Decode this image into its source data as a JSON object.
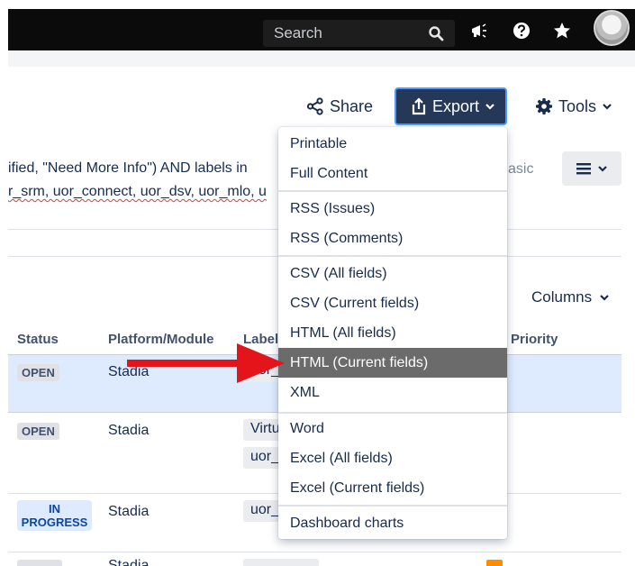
{
  "topbar": {
    "search_placeholder": "Search"
  },
  "toolbar": {
    "share_label": "Share",
    "export_label": "Export",
    "tools_label": "Tools"
  },
  "jql": {
    "line1": "ified, \"Need More Info\") AND labels in",
    "line2": "r_srm, uor_connect, uor_dsv, uor_mlo, u",
    "basic_label": "asic"
  },
  "columns_label": "Columns",
  "table": {
    "headers": {
      "status": "Status",
      "platform": "Platform/Module",
      "labels": "Labels",
      "priority": "Priority"
    },
    "rows": [
      {
        "status": "OPEN",
        "platform": "Stadia",
        "labels": [
          "uor_"
        ]
      },
      {
        "status": "OPEN",
        "platform": "Stadia",
        "labels": [
          "Virtu",
          "uor_"
        ]
      },
      {
        "status_line1": "IN",
        "status_line2": "PROGRESS",
        "platform": "Stadia",
        "labels": [
          "uor_"
        ]
      },
      {
        "platform": "Stadia"
      }
    ]
  },
  "export_menu": {
    "items": [
      "Printable",
      "Full Content",
      "RSS (Issues)",
      "RSS (Comments)",
      "CSV (All fields)",
      "CSV (Current fields)",
      "HTML (All fields)",
      "HTML (Current fields)",
      "XML",
      "Word",
      "Excel (All fields)",
      "Excel (Current fields)",
      "Dashboard charts"
    ],
    "highlighted": "HTML (Current fields)"
  },
  "colors": {
    "topbar": "#0b0b0b",
    "export_button": "#253858",
    "focus_ring": "#4c9aff",
    "menu_highlight": "#6b6b6b",
    "selected_row": "#deebff",
    "annotation_arrow": "#e3151a"
  },
  "icons": {
    "search": "search-icon",
    "announcement": "megaphone-icon",
    "help": "help-icon",
    "star": "star-icon",
    "share": "share-icon",
    "export": "export-upload-icon",
    "tools": "gear-icon",
    "list_view": "list-view-icon",
    "chevron": "chevron-down-icon"
  }
}
